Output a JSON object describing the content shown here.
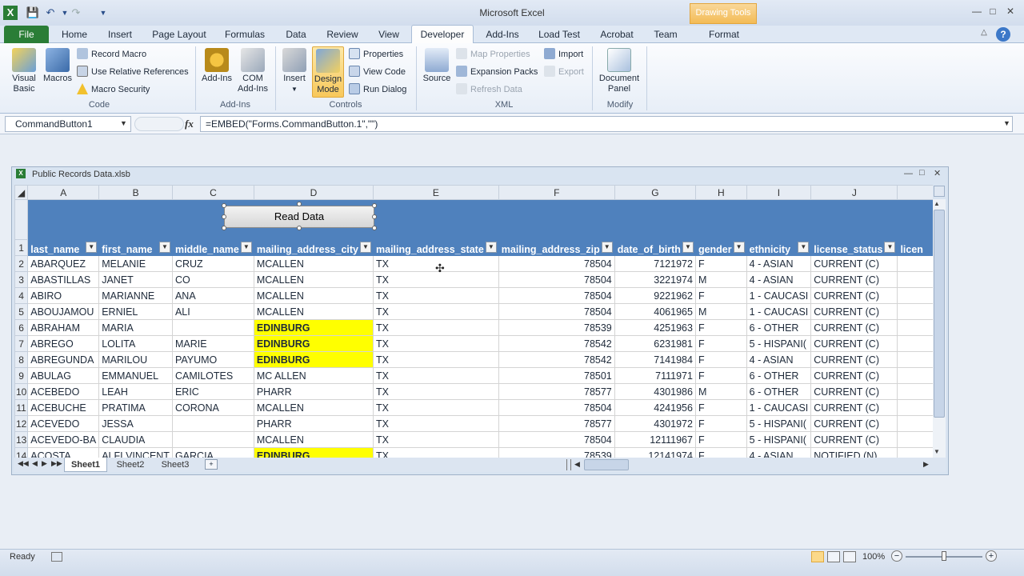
{
  "app": {
    "title": "Microsoft Excel",
    "contextual_tab": "Drawing Tools"
  },
  "tabs": [
    "File",
    "Home",
    "Insert",
    "Page Layout",
    "Formulas",
    "Data",
    "Review",
    "View",
    "Developer",
    "Add-Ins",
    "Load Test",
    "Acrobat",
    "Team",
    "Format"
  ],
  "active_tab": "Developer",
  "ribbon": {
    "code": {
      "visual_basic": "Visual Basic",
      "macros": "Macros",
      "record_macro": "Record Macro",
      "relative_refs": "Use Relative References",
      "macro_security": "Macro Security",
      "label": "Code"
    },
    "addins": {
      "addins": "Add-Ins",
      "com_addins": "COM Add-Ins",
      "label": "Add-Ins"
    },
    "controls": {
      "insert": "Insert",
      "design_mode": "Design Mode",
      "properties": "Properties",
      "view_code": "View Code",
      "run_dialog": "Run Dialog",
      "label": "Controls"
    },
    "xml": {
      "source": "Source",
      "map_properties": "Map Properties",
      "expansion_packs": "Expansion Packs",
      "refresh_data": "Refresh Data",
      "import": "Import",
      "export": "Export",
      "label": "XML"
    },
    "modify": {
      "document_panel": "Document Panel",
      "label": "Modify"
    }
  },
  "formula_bar": {
    "name_box": "CommandButton1",
    "fx": "fx",
    "formula": "=EMBED(\"Forms.CommandButton.1\",\"\")"
  },
  "workbook": {
    "title": "Public Records Data.xlsb",
    "button_label": "Read Data"
  },
  "columns": [
    "A",
    "B",
    "C",
    "D",
    "E",
    "F",
    "G",
    "H",
    "I",
    "J"
  ],
  "headers": [
    "last_name",
    "first_name",
    "middle_name",
    "mailing_address_city",
    "mailing_address_state",
    "mailing_address_zip",
    "date_of_birth",
    "gender",
    "ethnicity",
    "license_status",
    "licen"
  ],
  "rows": [
    {
      "n": "2",
      "c": [
        "ABARQUEZ",
        "MELANIE",
        "CRUZ",
        "MCALLEN",
        "TX",
        "78504",
        "7121972",
        "F",
        "4 - ASIAN",
        "CURRENT (C)"
      ],
      "hl": false
    },
    {
      "n": "3",
      "c": [
        "ABASTILLAS",
        "JANET",
        "CO",
        "MCALLEN",
        "TX",
        "78504",
        "3221974",
        "M",
        "4 - ASIAN",
        "CURRENT (C)"
      ],
      "hl": false
    },
    {
      "n": "4",
      "c": [
        "ABIRO",
        "MARIANNE",
        "ANA",
        "MCALLEN",
        "TX",
        "78504",
        "9221962",
        "F",
        "1 - CAUCASI",
        "CURRENT (C)"
      ],
      "hl": false
    },
    {
      "n": "5",
      "c": [
        "ABOUJAMOU",
        "ERNIEL",
        "ALI",
        "MCALLEN",
        "TX",
        "78504",
        "4061965",
        "M",
        "1 - CAUCASI",
        "CURRENT (C)"
      ],
      "hl": false
    },
    {
      "n": "6",
      "c": [
        "ABRAHAM",
        "MARIA",
        "",
        "EDINBURG",
        "TX",
        "78539",
        "4251963",
        "F",
        "6 - OTHER",
        "CURRENT (C)"
      ],
      "hl": true
    },
    {
      "n": "7",
      "c": [
        "ABREGO",
        "LOLITA",
        "MARIE",
        "EDINBURG",
        "TX",
        "78542",
        "6231981",
        "F",
        "5 - HISPANI(",
        "CURRENT (C)"
      ],
      "hl": true
    },
    {
      "n": "8",
      "c": [
        "ABREGUNDA",
        "MARILOU",
        "PAYUMO",
        "EDINBURG",
        "TX",
        "78542",
        "7141984",
        "F",
        "4 - ASIAN",
        "CURRENT (C)"
      ],
      "hl": true
    },
    {
      "n": "9",
      "c": [
        "ABULAG",
        "EMMANUEL",
        "CAMILOTES",
        "MC ALLEN",
        "TX",
        "78501",
        "7111971",
        "F",
        "6 - OTHER",
        "CURRENT (C)"
      ],
      "hl": false
    },
    {
      "n": "10",
      "c": [
        "ACEBEDO",
        "LEAH",
        "ERIC",
        "PHARR",
        "TX",
        "78577",
        "4301986",
        "M",
        "6 - OTHER",
        "CURRENT (C)"
      ],
      "hl": false
    },
    {
      "n": "11",
      "c": [
        "ACEBUCHE",
        "PRATIMA",
        "CORONA",
        "MCALLEN",
        "TX",
        "78504",
        "4241956",
        "F",
        "1 - CAUCASI",
        "CURRENT (C)"
      ],
      "hl": false
    },
    {
      "n": "12",
      "c": [
        "ACEVEDO",
        "JESSA",
        "",
        "PHARR",
        "TX",
        "78577",
        "4301972",
        "F",
        "5 - HISPANI(",
        "CURRENT (C)"
      ],
      "hl": false
    },
    {
      "n": "13",
      "c": [
        "ACEVEDO-BA",
        "CLAUDIA",
        "",
        "MCALLEN",
        "TX",
        "78504",
        "12111967",
        "F",
        "5 - HISPANI(",
        "CURRENT (C)"
      ],
      "hl": false
    },
    {
      "n": "14",
      "c": [
        "ACOSTA",
        "ALFI VINCENT",
        "GARCIA",
        "EDINBURG",
        "TX",
        "78539",
        "12141974",
        "F",
        "4 - ASIAN",
        "NOTIFIED (N)"
      ],
      "hl": true
    }
  ],
  "sheets": [
    "Sheet1",
    "Sheet2",
    "Sheet3"
  ],
  "status": {
    "ready": "Ready",
    "zoom": "100%"
  }
}
